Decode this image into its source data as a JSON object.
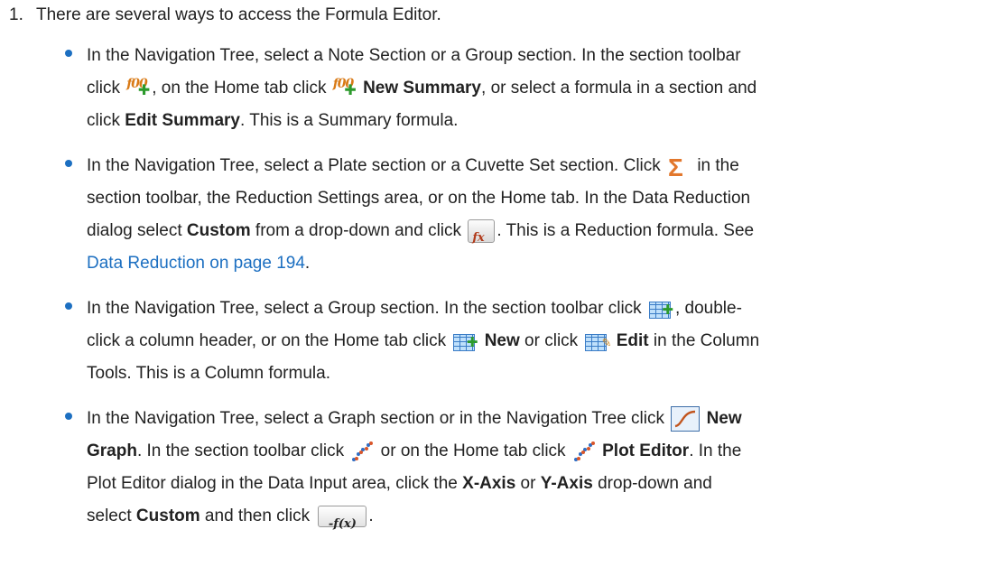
{
  "step": {
    "number": "1.",
    "intro": "There are several ways to access the Formula Editor."
  },
  "bullets": [
    {
      "lines": [
        [
          "In the Navigation Tree, select a Note Section or a Group section. In the section toolbar"
        ],
        [
          "click ",
          "{fx-plus}",
          ", on the Home tab click ",
          "{fx-plus}",
          " ",
          "**New Summary",
          ", or select a formula in a section and"
        ],
        [
          "click ",
          "**Edit Summary",
          ". This is a Summary formula."
        ]
      ]
    }
  ],
  "text": {
    "b1_l1": "In the Navigation Tree, select a Note Section or a Group section. In the section toolbar",
    "b1_l2_a": "click ",
    "b1_l2_b": ", on the Home tab click ",
    "b1_l2_c": "New Summary",
    "b1_l2_d": ", or select a formula in a section and",
    "b1_l3_a": "click ",
    "b1_l3_b": "Edit Summary",
    "b1_l3_c": ". This is a Summary formula.",
    "b2_l1_a": "In the Navigation Tree, select a Plate section or a Cuvette Set section. Click ",
    "b2_l1_b": " in the",
    "b2_l2": "section toolbar, the Reduction Settings area, or on the Home tab. In the Data Reduction",
    "b2_l3_a": "dialog select ",
    "b2_l3_b": "Custom",
    "b2_l3_c": " from a drop-down and click ",
    "b2_l3_d": ". This is a Reduction formula. See",
    "b2_l4_link": "Data Reduction on page 194",
    "b2_l4_end": ".",
    "b3_l1_a": "In the Navigation Tree, select a Group section. In the section toolbar click ",
    "b3_l1_b": ", double-",
    "b3_l2_a": "click a column header, or on the Home tab click ",
    "b3_l2_b": "New",
    "b3_l2_c": " or click ",
    "b3_l2_d": "Edit",
    "b3_l2_e": " in the Column",
    "b3_l3": "Tools. This is a Column formula.",
    "b4_l1_a": "In the Navigation Tree, select a Graph section or in the Navigation Tree click ",
    "b4_l1_b": "New",
    "b4_l2_a": "Graph",
    "b4_l2_b": ". In the section toolbar click ",
    "b4_l2_c": " or on the Home tab click ",
    "b4_l2_d": "Plot Editor",
    "b4_l2_e": ". In the",
    "b4_l3_a": "Plot Editor dialog in the Data Input area, click the ",
    "b4_l3_b": "X-Axis",
    "b4_l3_c": " or ",
    "b4_l3_d": "Y-Axis",
    "b4_l3_e": " drop-down and",
    "b4_l4_a": "select ",
    "b4_l4_b": "Custom",
    "b4_l4_c": " and then click ",
    "b4_l4_d": "."
  },
  "icons": {
    "formula_plus": "formula-new-icon",
    "sigma": "sigma-reduction-icon",
    "formula_button": "formula-button-icon",
    "table_plus": "table-new-column-icon",
    "table_edit": "table-edit-column-icon",
    "graph": "new-graph-icon",
    "plot": "plot-editor-icon",
    "fx_button": "fx-button-icon",
    "fx_button_label": "-f(x)",
    "fx_label": "f00",
    "formula_button_label": "fx"
  },
  "colors": {
    "link": "#1c6fc1",
    "bullet": "#1c6fc1",
    "text": "#222222"
  }
}
